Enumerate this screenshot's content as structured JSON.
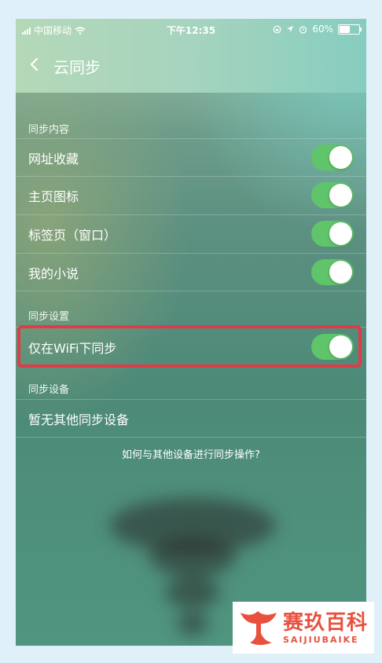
{
  "status_bar": {
    "carrier": "中国移动",
    "time": "下午12:35",
    "battery": "60%",
    "battery_level": 0.6
  },
  "navbar": {
    "title": "云同步"
  },
  "sections": {
    "content": {
      "header": "同步内容",
      "items": [
        {
          "label": "网址收藏",
          "on": true
        },
        {
          "label": "主页图标",
          "on": true
        },
        {
          "label": "标签页（窗口）",
          "on": true
        },
        {
          "label": "我的小说",
          "on": true
        }
      ]
    },
    "settings": {
      "header": "同步设置",
      "items": [
        {
          "label": "仅在WiFi下同步",
          "on": true
        }
      ]
    },
    "devices": {
      "header": "同步设备",
      "empty_label": "暂无其他同步设备"
    }
  },
  "help_link": "如何与其他设备进行同步操作?",
  "watermark": {
    "cn": "赛玖百科",
    "en": "SAIJIUBAIKE"
  },
  "colors": {
    "toggle_on": "#5fc46a",
    "highlight": "#e23b47",
    "watermark": "#e8513e"
  }
}
